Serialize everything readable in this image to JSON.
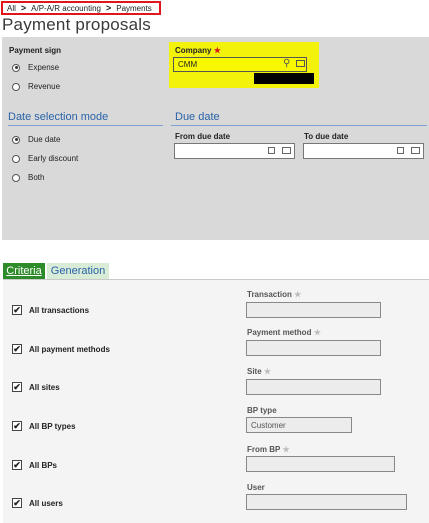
{
  "breadcrumb": {
    "items": [
      "All",
      "A/P-A/R accounting",
      "Payments"
    ],
    "separator": ">"
  },
  "page_title": "Payment proposals",
  "payment_sign": {
    "label": "Payment sign",
    "options": [
      {
        "label": "Expense",
        "selected": true
      },
      {
        "label": "Revenue",
        "selected": false
      }
    ]
  },
  "company": {
    "label": "Company",
    "required_mark": "★",
    "value": "CMM"
  },
  "date_selection_mode": {
    "title": "Date selection mode",
    "options": [
      {
        "label": "Due date",
        "selected": true
      },
      {
        "label": "Early discount",
        "selected": false
      },
      {
        "label": "Both",
        "selected": false
      }
    ]
  },
  "due_date": {
    "title": "Due date",
    "from_label": "From due date",
    "to_label": "To due date",
    "from_value": "",
    "to_value": ""
  },
  "tabs": {
    "criteria": "Criteria",
    "generation": "Generation",
    "active": "criteria"
  },
  "criteria": {
    "rows": [
      {
        "check_label": "All transactions",
        "checked": true,
        "field_label": "Transaction",
        "field_mark": "★",
        "field_value": ""
      },
      {
        "check_label": "All payment methods",
        "checked": true,
        "field_label": "Payment method",
        "field_mark": "★",
        "field_value": ""
      },
      {
        "check_label": "All sites",
        "checked": true,
        "field_label": "Site",
        "field_mark": "★",
        "field_value": ""
      },
      {
        "check_label": "All BP types",
        "checked": true,
        "field_label": "BP type",
        "field_mark": "",
        "field_value": "Customer"
      },
      {
        "check_label": "All BPs",
        "checked": true,
        "field_label": "From BP",
        "field_mark": "★",
        "field_value": ""
      },
      {
        "check_label": "All users",
        "checked": true,
        "field_label": "User",
        "field_mark": "",
        "field_value": ""
      }
    ]
  },
  "colors": {
    "highlight_yellow": "#f2f20a",
    "accent_blue": "#2a62a8",
    "tab_green": "#2e8b2a",
    "breadcrumb_border": "#e0161b"
  }
}
